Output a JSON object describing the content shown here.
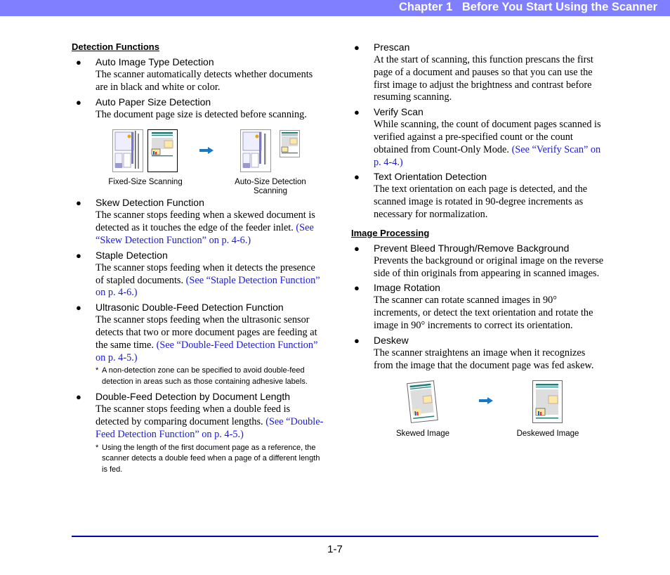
{
  "header": {
    "title": "Chapter 1   Before You Start Using the Scanner",
    "bar_color": "#7f7fff"
  },
  "left": {
    "section_heading": "Detection Functions",
    "items": [
      {
        "title": "Auto Image Type Detection",
        "body": "The scanner automatically detects whether documents are in black and white or color.",
        "link": ""
      },
      {
        "title": "Auto Paper Size Detection",
        "body": "The document page size is detected before scanning.",
        "link": ""
      },
      {
        "title": "Skew Detection Function",
        "body": "The scanner stops feeding when a skewed document is detected as it touches the edge of the feeder inlet. ",
        "link": "(See “Skew Detection Function” on p. 4-6.)"
      },
      {
        "title": "Staple Detection",
        "body": "The scanner stops feeding when it detects the presence of stapled documents. ",
        "link": "(See “Staple Detection Function” on p. 4-6.)"
      },
      {
        "title": "Ultrasonic Double-Feed Detection Function",
        "body": "The scanner stops feeding when the ultrasonic sensor detects that two or more document pages are feeding at the same time. ",
        "link": "(See “Double-Feed Detection Function” on p. 4-5.)",
        "note": "A non-detection zone can be specified to avoid double-feed detection in areas such as those containing adhesive labels."
      },
      {
        "title": "Double-Feed Detection by Document Length",
        "body": "The scanner stops feeding when a double feed is detected by comparing document lengths. ",
        "link": "(See “Double-Feed Detection Function” on p. 4-5.)",
        "note": "Using the length of the first document page as a reference, the scanner detects a double feed when a page of a different length is fed."
      }
    ],
    "figure": {
      "caption_before": "Fixed-Size Scanning",
      "caption_after": "Auto-Size Detection Scanning"
    }
  },
  "right": {
    "items_top": [
      {
        "title": "Prescan",
        "body": "At the start of scanning, this function prescans the first page of a document and pauses so that you can use the first image to adjust the brightness and contrast before resuming scanning.",
        "link": ""
      },
      {
        "title": "Verify Scan",
        "body": "While scanning, the count of document pages scanned is verified against a pre-specified count or the count obtained from Count-Only Mode. ",
        "link": "(See “Verify Scan” on p. 4-4.)"
      },
      {
        "title": "Text Orientation Detection",
        "body": "The text orientation on each page is detected, and the scanned image is rotated in 90-degree increments as necessary for normalization.",
        "link": ""
      }
    ],
    "section_heading": "Image Processing",
    "items": [
      {
        "title": "Prevent Bleed Through/Remove Background",
        "body": "Prevents the background or original image on the reverse side of thin originals from appearing in scanned images.",
        "link": ""
      },
      {
        "title": "Image Rotation",
        "body": "The scanner can rotate scanned images in 90° increments, or detect the text orientation and rotate the image in 90° increments to correct its orientation.",
        "link": ""
      },
      {
        "title": "Deskew",
        "body": "The scanner straightens an image when it recognizes from the image that the document page was fed askew.",
        "link": ""
      }
    ],
    "figure": {
      "caption_before": "Skewed Image",
      "caption_after": "Deskewed Image"
    }
  },
  "footer": {
    "page_number": "1-7",
    "rule_color": "#0000c0"
  },
  "icons": {
    "bullet": "●",
    "arrow": "arrow-right-icon",
    "note_marker": "*"
  },
  "colors": {
    "link": "#1a1ad6",
    "arrow": "#1a78c2",
    "doc_teal": "#1f7a78"
  }
}
